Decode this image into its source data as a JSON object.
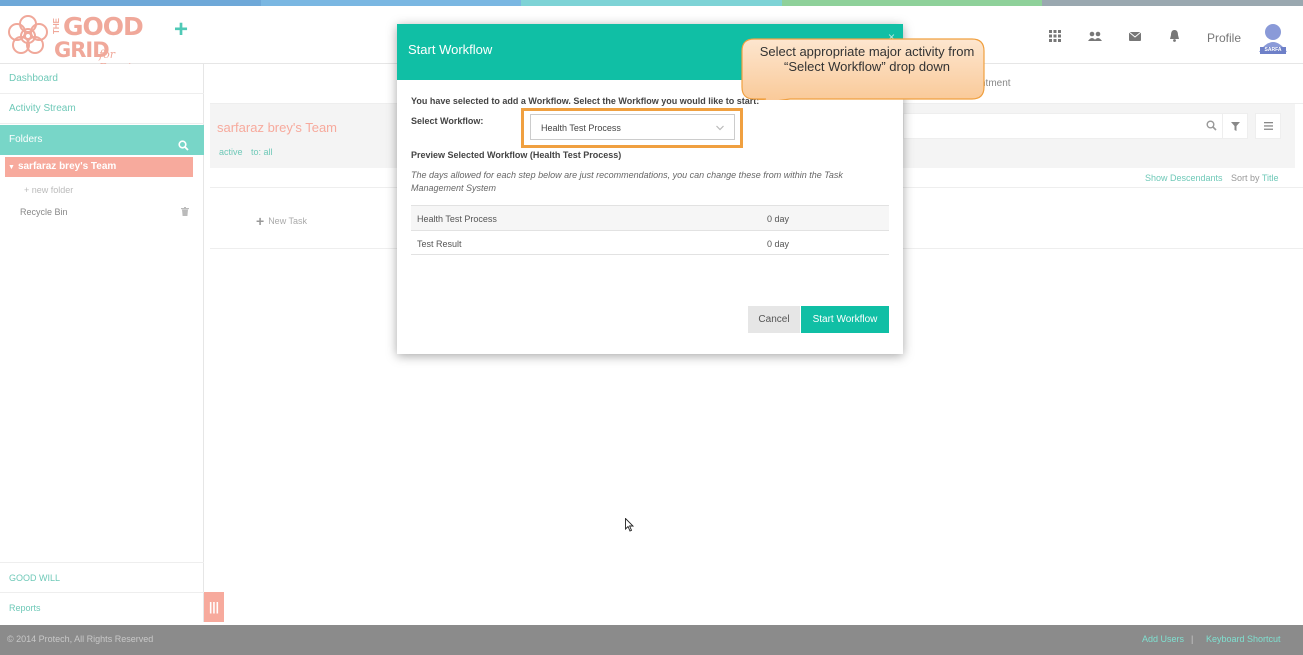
{
  "top_strip": {
    "colors": [
      "#6ea8d8",
      "#7ab7e2",
      "#7ed3d6",
      "#8fd19a",
      "#9aa8b0"
    ]
  },
  "header": {
    "logo": {
      "the": "THE",
      "good": "GOOD",
      "grid": "GRID",
      "sub": "for Reentry"
    },
    "add_icon": "plus-icon",
    "icons": [
      "apps-grid-icon",
      "users-icon",
      "mail-icon",
      "bell-icon"
    ],
    "profile_label": "Profile",
    "avatar_badge": "SARFA"
  },
  "sidebar": {
    "dashboard": "Dashboard",
    "activity_stream": "Activity Stream",
    "folders": "Folders",
    "team": "sarfaraz brey's Team",
    "new_folder": "+ new folder",
    "recycle_bin": "Recycle Bin",
    "good_will": "GOOD WILL",
    "reports": "Reports"
  },
  "main": {
    "tab_partial": "ntment",
    "team_title": "sarfaraz brey's Team",
    "filter_active": "active",
    "filter_to": "to: all",
    "show_descendants": "Show Descendants",
    "sort_by": "Sort by",
    "sort_title": "Title",
    "new_task": "New Task"
  },
  "footer": {
    "copyright": "© 2014 Protech, All Rights Reserved",
    "add_users": "Add Users",
    "separator": "|",
    "keyboard_shortcut": "Keyboard Shortcut"
  },
  "modal": {
    "title": "Start Workflow",
    "close": "×",
    "intro": "You have selected to add a Workflow. Select the Workflow you would like to start:",
    "select_label": "Select Workflow:",
    "select_value": "Health Test Process",
    "preview_title": "Preview Selected Workflow (Health Test Process)",
    "note": "The days allowed for each step below are just recommendations, you can change these from within the Task Management System",
    "steps": [
      {
        "name": "Health Test Process",
        "days": "0 day"
      },
      {
        "name": "Test Result",
        "days": "0 day"
      }
    ],
    "cancel_label": "Cancel",
    "start_label": "Start Workflow"
  },
  "callout": {
    "text": "Select appropriate major activity from “Select Workflow” drop down",
    "fill": "#fcd5b0",
    "stroke": "#f0a040"
  },
  "colors": {
    "teal": "#10bfa5",
    "mint": "#78d6c8",
    "salmon": "#f7aa9d"
  }
}
